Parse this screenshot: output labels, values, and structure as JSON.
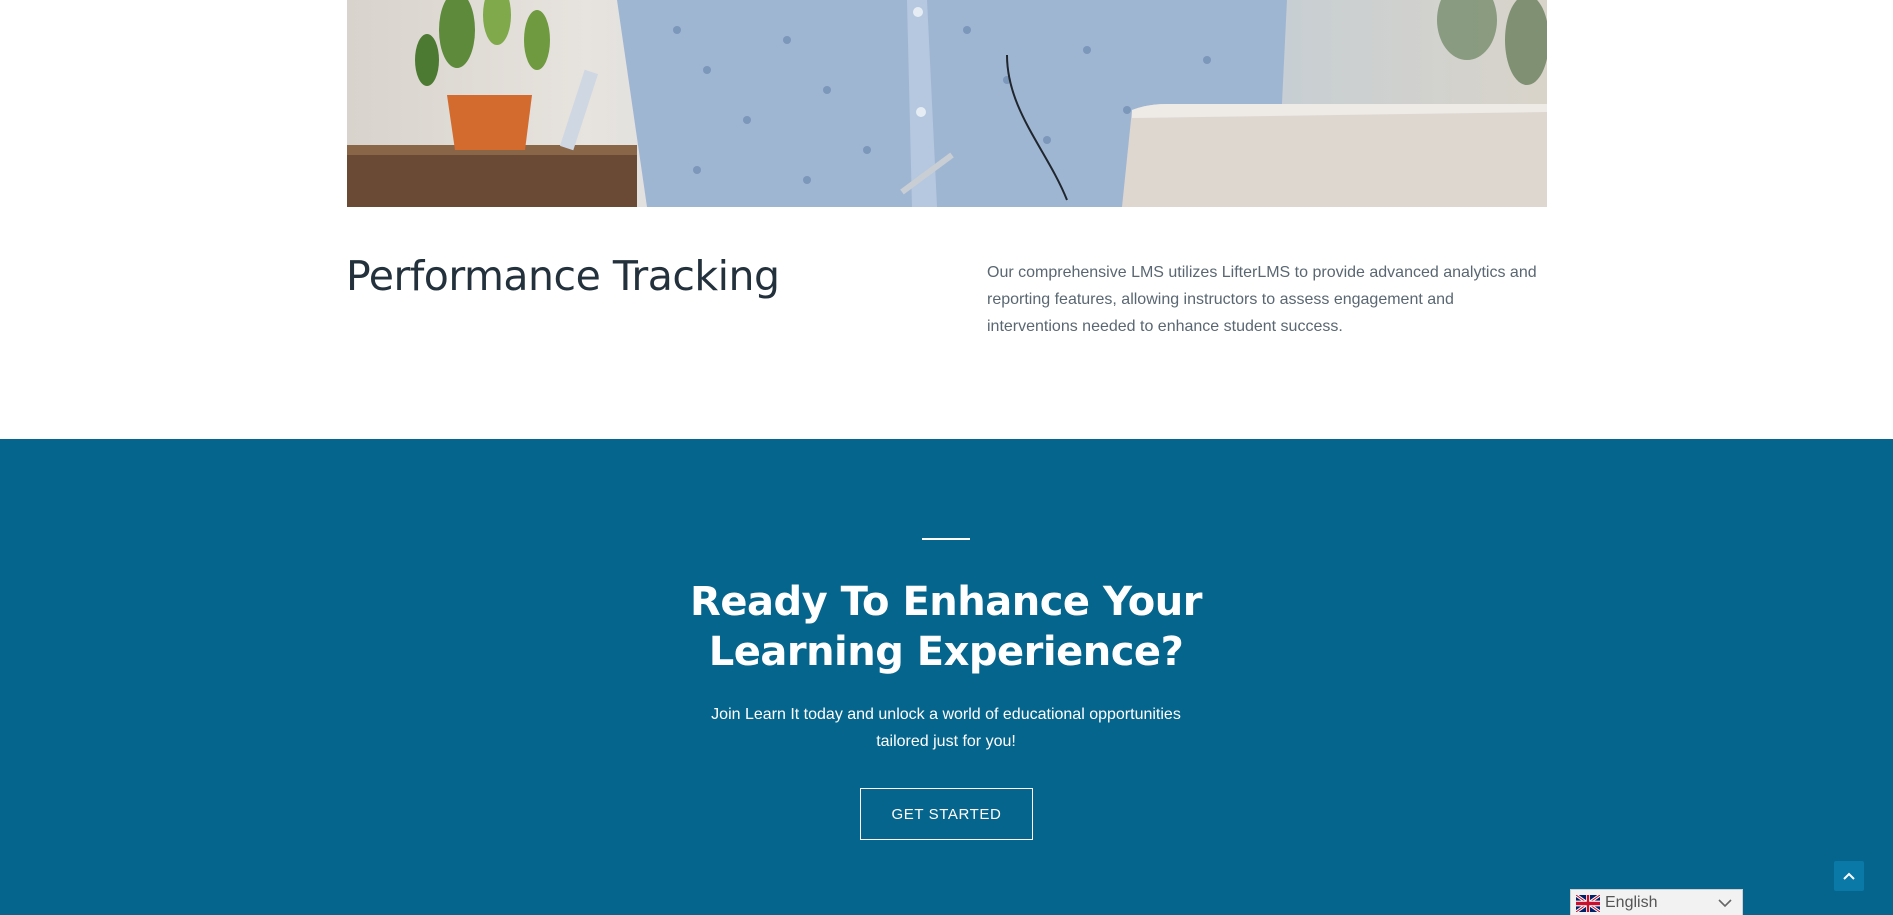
{
  "performance": {
    "title": "Performance Tracking",
    "description": "Our comprehensive LMS utilizes LifterLMS to provide advanced analytics and reporting features, allowing instructors to assess engagement and interventions needed to enhance student success."
  },
  "cta": {
    "heading": "Ready To Enhance Your Learning Experience?",
    "subtext": "Join Learn It today and unlock a world of educational opportunities tailored just for you!",
    "button_label": "GET STARTED",
    "background_color": "#05658d"
  },
  "language": {
    "selected": "English",
    "flag_icon": "uk-flag-icon"
  },
  "scroll_top": {
    "icon": "chevron-up-icon"
  }
}
